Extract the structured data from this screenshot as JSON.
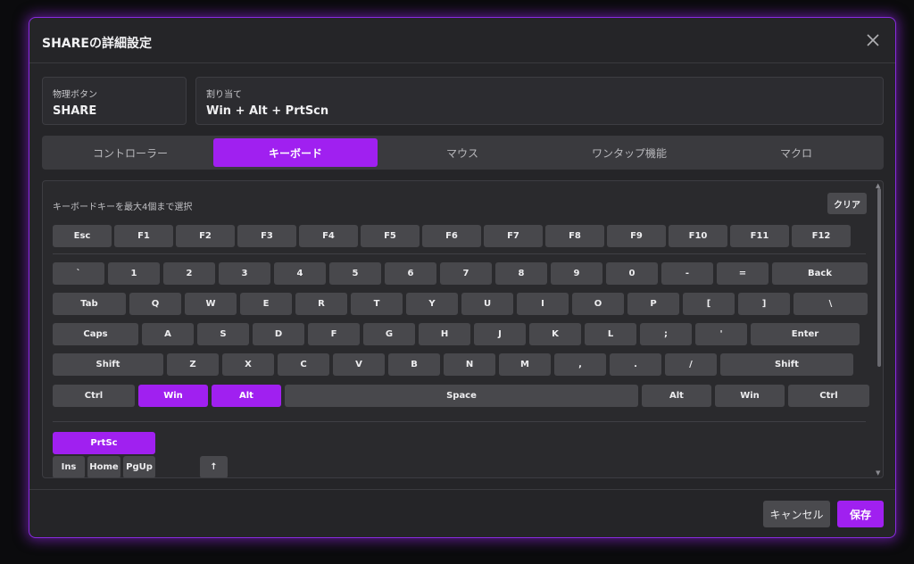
{
  "dialog": {
    "title": "SHAREの詳細設定",
    "physical_button": {
      "label": "物理ボタン",
      "value": "SHARE"
    },
    "assignment": {
      "label": "割り当て",
      "value": "Win + Alt + PrtScn"
    }
  },
  "tabs": [
    {
      "label": "コントローラー",
      "active": false
    },
    {
      "label": "キーボード",
      "active": true
    },
    {
      "label": "マウス",
      "active": false
    },
    {
      "label": "ワンタップ機能",
      "active": false
    },
    {
      "label": "マクロ",
      "active": false
    }
  ],
  "keyboard": {
    "hint": "キーボードキーを最大4個まで選択",
    "clear_label": "クリア",
    "rows": [
      [
        "Esc",
        "F1",
        "F2",
        "F3",
        "F4",
        "F5",
        "F6",
        "F7",
        "F8",
        "F9",
        "F10",
        "F11",
        "F12"
      ],
      [
        "`",
        "1",
        "2",
        "3",
        "4",
        "5",
        "6",
        "7",
        "8",
        "9",
        "0",
        "-",
        "=",
        "Back"
      ],
      [
        "Tab",
        "Q",
        "W",
        "E",
        "R",
        "T",
        "Y",
        "U",
        "I",
        "O",
        "P",
        "[",
        "]",
        "\\"
      ],
      [
        "Caps",
        "A",
        "S",
        "D",
        "F",
        "G",
        "H",
        "J",
        "K",
        "L",
        ";",
        "'",
        "Enter"
      ],
      [
        "Shift",
        "Z",
        "X",
        "C",
        "V",
        "B",
        "N",
        "M",
        ",",
        ".",
        "/",
        "Shift"
      ],
      [
        "Ctrl",
        "Win",
        "Alt",
        "Space",
        "Alt",
        "Win",
        "Ctrl"
      ]
    ],
    "nav_rows": [
      [
        "PrtSc"
      ],
      [
        "Ins",
        "Home",
        "PgUp",
        "↑"
      ]
    ],
    "selected": [
      "Win",
      "Alt",
      "PrtSc"
    ]
  },
  "footer": {
    "cancel_label": "キャンセル",
    "save_label": "保存"
  },
  "colors": {
    "accent": "#a020f0",
    "background": "#252528",
    "key": "#48484c"
  }
}
